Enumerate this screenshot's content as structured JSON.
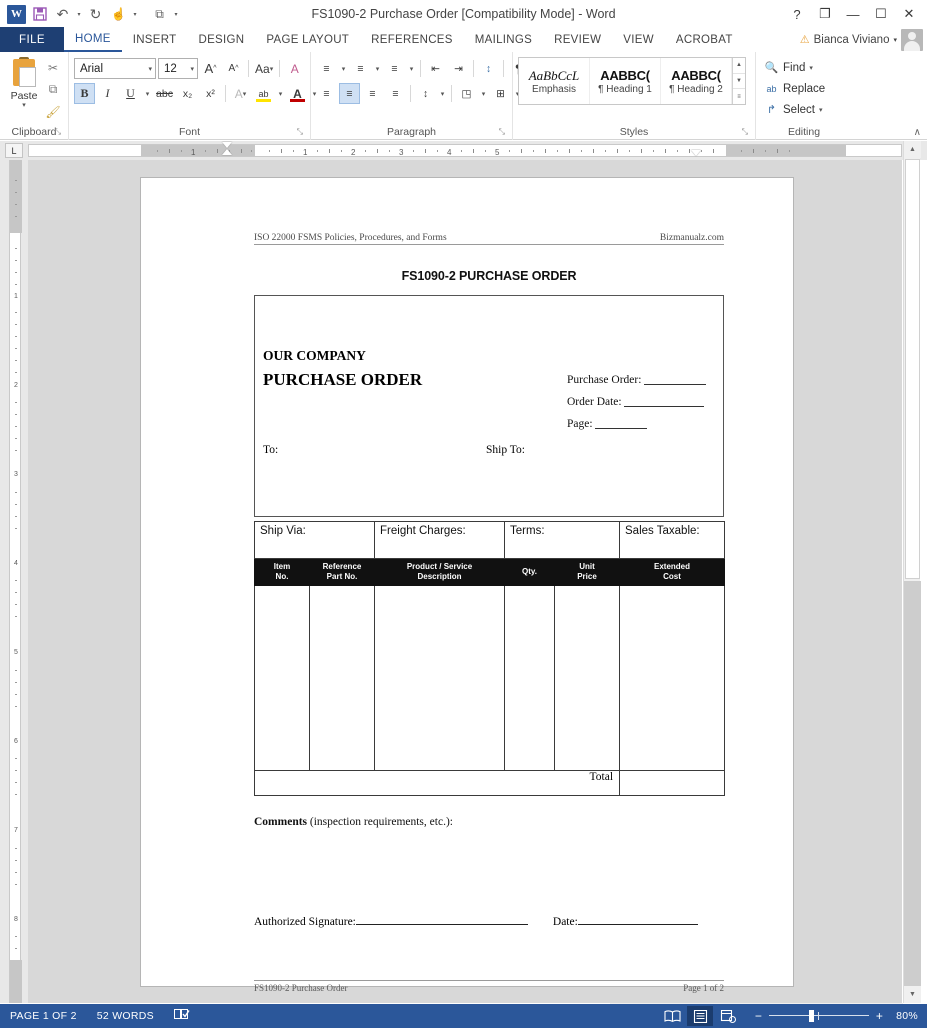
{
  "window": {
    "title": "FS1090-2 Purchase Order [Compatibility Mode] - Word",
    "help": "?",
    "ribbon_display": "❐",
    "minimize": "—",
    "maximize": "☐",
    "close": "✕"
  },
  "quick_access": {
    "logo": "W",
    "save": "💾",
    "undo": "↶",
    "undo_arrow": "▾",
    "redo": "↻",
    "touch": "☝",
    "touch_arrow": "▾",
    "customize_icon": "⧉",
    "customize_arrow": "▾"
  },
  "tabs": [
    {
      "label": "FILE",
      "active": false
    },
    {
      "label": "HOME",
      "active": true
    },
    {
      "label": "INSERT",
      "active": false
    },
    {
      "label": "DESIGN",
      "active": false
    },
    {
      "label": "PAGE LAYOUT",
      "active": false
    },
    {
      "label": "REFERENCES",
      "active": false
    },
    {
      "label": "MAILINGS",
      "active": false
    },
    {
      "label": "REVIEW",
      "active": false
    },
    {
      "label": "VIEW",
      "active": false
    },
    {
      "label": "ACROBAT",
      "active": false
    }
  ],
  "account": {
    "warning_icon": "⚠",
    "name": "Bianca Viviano",
    "dropdown": "▾"
  },
  "ribbon": {
    "groups": [
      {
        "name": "Clipboard",
        "label": "Clipboard"
      },
      {
        "name": "Font",
        "label": "Font"
      },
      {
        "name": "Paragraph",
        "label": "Paragraph"
      },
      {
        "name": "Styles",
        "label": "Styles"
      },
      {
        "name": "Editing",
        "label": "Editing"
      }
    ],
    "clipboard": {
      "paste_label": "Paste",
      "paste_arrow": "▾",
      "cut": "✂",
      "copy": "⧉",
      "format_painter": "🖌",
      "launcher": "⤡"
    },
    "font": {
      "font_family": "Arial",
      "font_size": "12",
      "grow_font": "A",
      "shrink_font": "A",
      "change_case": "Aa",
      "clear_formatting": "A",
      "bold": "B",
      "italic": "I",
      "underline": "U",
      "strikethrough": "abc",
      "subscript": "x₂",
      "superscript": "x²",
      "text_effects": "A",
      "highlight": "ab",
      "font_color": "A",
      "arrow": "▾",
      "launcher": "⤡"
    },
    "paragraph": {
      "bullets": "≡",
      "numbering": "≡",
      "multilevel": "≡",
      "decrease_indent": "⇤",
      "increase_indent": "⇥",
      "sort": "↕",
      "show_marks": "¶",
      "align_left": "≡",
      "align_center": "≡",
      "align_right": "≡",
      "justify": "≡",
      "line_spacing": "↕",
      "shading": "◳",
      "borders": "⊞",
      "arrow": "▾",
      "launcher": "⤡"
    },
    "styles": {
      "items": [
        {
          "preview": "AaBbCcL",
          "name": "Emphasis",
          "style": "em"
        },
        {
          "preview": "AABBC(",
          "name": "¶ Heading 1",
          "style": "hd"
        },
        {
          "preview": "AABBC(",
          "name": "¶ Heading 2",
          "style": "hd"
        }
      ],
      "scroll_up": "▲",
      "scroll_down": "▼",
      "more": "≡",
      "launcher": "⤡"
    },
    "editing": {
      "find_label": "Find",
      "find_icon": "🔍",
      "find_arrow": "▾",
      "replace_label": "Replace",
      "replace_icon": "ab",
      "select_label": "Select",
      "select_icon": "↱",
      "select_arrow": "▾"
    },
    "collapse_icon": "∧"
  },
  "ruler": {
    "tab_selector": "L",
    "horizontal_ticks": [
      "1",
      "1",
      "2",
      "3",
      "4",
      "5"
    ],
    "vertical_ticks": [
      "1",
      "2",
      "3",
      "4",
      "5",
      "6",
      "7",
      "8"
    ]
  },
  "document": {
    "header": {
      "left": "ISO 22000 FSMS Policies, Procedures, and Forms",
      "right": "Bizmanualz.com"
    },
    "title": "FS1090-2 PURCHASE ORDER",
    "po_box": {
      "company": "OUR COMPANY",
      "heading": "PURCHASE ORDER",
      "fields": [
        {
          "label": "Purchase Order:",
          "line_width": 62
        },
        {
          "label": "Order Date:",
          "line_width": 80
        },
        {
          "label": "Page:",
          "line_width": 52
        }
      ],
      "to_label": "To:",
      "ship_to_label": "Ship To:"
    },
    "ship_row": [
      "Ship Via:",
      "Freight Charges:",
      "Terms:",
      "Sales Taxable:"
    ],
    "table_headers": [
      {
        "line1": "Item",
        "line2": "No."
      },
      {
        "line1": "Reference",
        "line2": "Part No."
      },
      {
        "line1": "Product / Service",
        "line2": "Description"
      },
      {
        "line1": "Qty.",
        "line2": ""
      },
      {
        "line1": "Unit",
        "line2": "Price"
      },
      {
        "line1": "Extended",
        "line2": "Cost"
      }
    ],
    "total_label": "Total",
    "comments_bold": "Comments",
    "comments_rest": " (inspection requirements, etc.):",
    "signature_label": "Authorized Signature:",
    "date_label": "Date:",
    "footer": {
      "left": "FS1090-2 Purchase Order",
      "right": "Page 1 of 2"
    }
  },
  "status_bar": {
    "page_info": "PAGE 1 OF 2",
    "word_count": "52 WORDS",
    "proofing_icon": "📖",
    "read_mode_icon": "📖",
    "print_layout_icon": "▤",
    "web_layout_icon": "▧",
    "zoom_out": "−",
    "zoom_in": "+",
    "zoom_level": "80%"
  }
}
